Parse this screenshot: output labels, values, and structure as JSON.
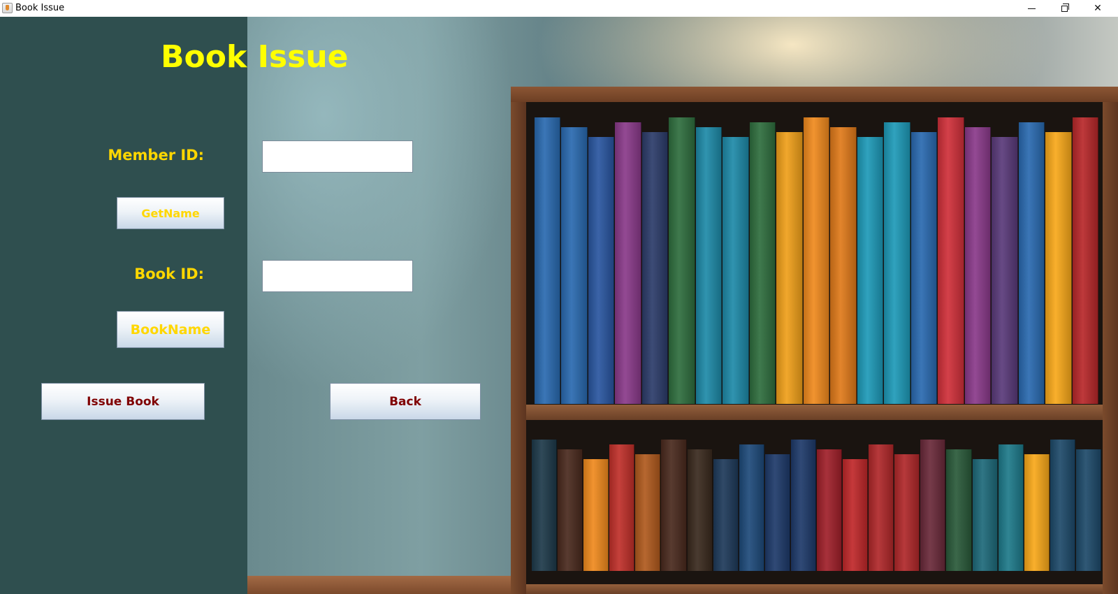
{
  "window": {
    "title": "Book Issue",
    "controls": [
      "minimize",
      "restore",
      "close"
    ]
  },
  "page": {
    "heading": "Book Issue",
    "heading_color": "#ffff00",
    "label_color": "#ffd700",
    "panel_color": "#2f4f4f"
  },
  "form": {
    "member_id_label": "Member ID:",
    "member_id_value": "",
    "book_id_label": "Book ID:",
    "book_id_value": "",
    "get_name_label": "GetName",
    "book_name_label": "BookName"
  },
  "actions": {
    "issue_label": "Issue Book",
    "back_label": "Back",
    "action_text_color": "#800000"
  },
  "background": {
    "image": "bookshelf-illustration",
    "top_shelf_colors": [
      "#2a6ab0",
      "#2a6ab0",
      "#2a56a0",
      "#8a3a8a",
      "#2c3c6a",
      "#2f6e3e",
      "#1e8aa8",
      "#1e8aa8",
      "#2f6e3e",
      "#f0a01a",
      "#f08a1e",
      "#e07a1a",
      "#1e9ab8",
      "#1e9ab8",
      "#2a6ab0",
      "#d0303a",
      "#8a3a8a",
      "#5a3a7a",
      "#2a6ab0",
      "#f8a81a",
      "#b8282a"
    ],
    "bottom_shelf_colors": [
      "#1e3a4a",
      "#4a2a1e",
      "#f08a1e",
      "#c0302a",
      "#b05a1e",
      "#4a2a1e",
      "#3a2a1e",
      "#1e3a5a",
      "#1e4a7a",
      "#1e3a6a",
      "#1e3a6a",
      "#a0202a",
      "#c0282a",
      "#b0282a",
      "#b0282a",
      "#6a2a3a",
      "#2a5a3a",
      "#1e6a7a",
      "#1e7a8a",
      "#f8a81a",
      "#1e4a6a",
      "#1e4a6a"
    ]
  }
}
